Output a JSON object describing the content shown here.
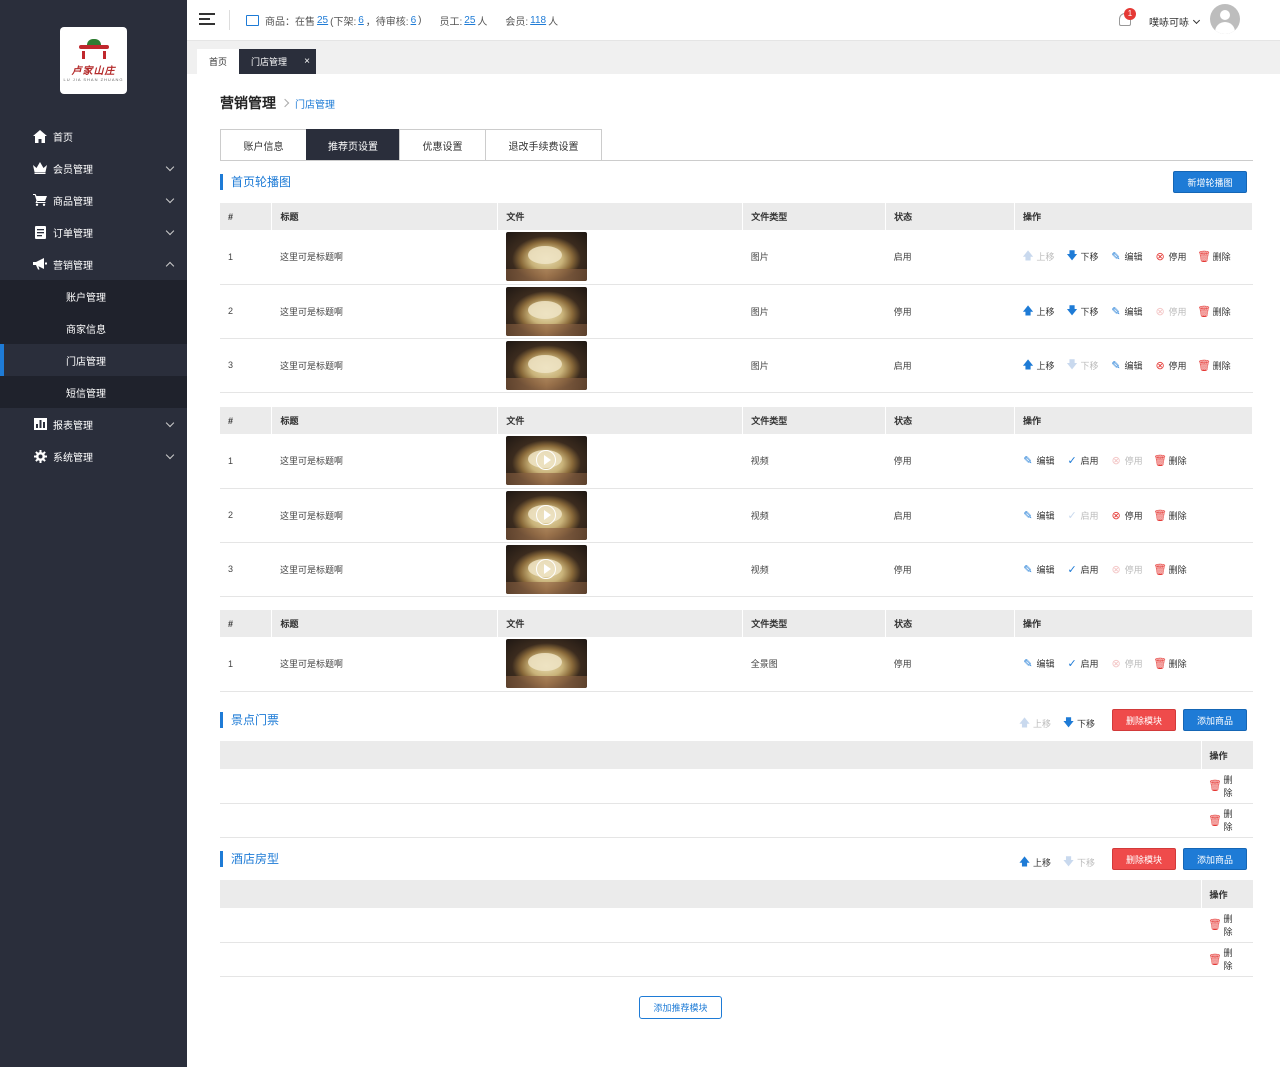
{
  "brand": {
    "name": "卢家山庄",
    "sub": "LU JIA SHAN ZHUANG"
  },
  "nav": {
    "items": [
      {
        "label": "首页",
        "icon": "home-icon"
      },
      {
        "label": "会员管理",
        "icon": "crown-icon"
      },
      {
        "label": "商品管理",
        "icon": "cart-icon"
      },
      {
        "label": "订单管理",
        "icon": "document-icon"
      },
      {
        "label": "营销管理",
        "icon": "megaphone-icon"
      },
      {
        "label": "报表管理",
        "icon": "chart-icon"
      },
      {
        "label": "系统管理",
        "icon": "gear-icon"
      }
    ],
    "sub": [
      "账户管理",
      "商家信息",
      "门店管理",
      "短信管理"
    ]
  },
  "topbar": {
    "goods_label": "商品：在售",
    "on_sale": "25",
    "off_label": "(下架:",
    "off": "6",
    "pending_label": "，待审核:",
    "pending": "6",
    "close": ")",
    "staff_label": "员工:",
    "staff": "25",
    "unit": "人",
    "member_label": "会员:",
    "members": "118",
    "notif_count": "1",
    "user": "噗哧可哧"
  },
  "page_tabs": {
    "home": "首页",
    "current": "门店管理",
    "close": "×"
  },
  "breadcrumb": {
    "parent": "营销管理",
    "current": "门店管理"
  },
  "sub_tabs": [
    "账户信息",
    "推荐页设置",
    "优惠设置",
    "退改手续费设置"
  ],
  "banner": {
    "title": "首页轮播图",
    "add_button": "新增轮播图",
    "headers": [
      "#",
      "标题",
      "文件",
      "文件类型",
      "状态",
      "操作"
    ]
  },
  "ops": {
    "up": "上移",
    "down": "下移",
    "edit": "编辑",
    "stop": "停用",
    "start": "启用",
    "delete": "删除"
  },
  "image_rows": [
    {
      "no": "1",
      "title": "这里可是标题啊",
      "type": "图片",
      "status": "启用"
    },
    {
      "no": "2",
      "title": "这里可是标题啊",
      "type": "图片",
      "status": "停用"
    },
    {
      "no": "3",
      "title": "这里可是标题啊",
      "type": "图片",
      "status": "启用"
    }
  ],
  "video_rows": [
    {
      "no": "1",
      "title": "这里可是标题啊",
      "type": "视频",
      "status": "停用"
    },
    {
      "no": "2",
      "title": "这里可是标题啊",
      "type": "视频",
      "status": "启用"
    },
    {
      "no": "3",
      "title": "这里可是标题啊",
      "type": "视频",
      "status": "停用"
    }
  ],
  "pano_rows": [
    {
      "no": "1",
      "title": "这里可是标题啊",
      "type": "全景图",
      "status": "停用"
    }
  ],
  "modules": [
    {
      "title": "景点门票",
      "up": "上移",
      "down": "下移",
      "delete_module": "删除模块",
      "add_goods": "添加商品",
      "op_header": "操作"
    },
    {
      "title": "酒店房型",
      "up": "上移",
      "down": "下移",
      "delete_module": "删除模块",
      "add_goods": "添加商品",
      "op_header": "操作"
    }
  ],
  "add_module": "添加推荐模块",
  "colors": {
    "accent": "#1e7bd6",
    "sidebar": "#2a2e3b",
    "danger": "#ef4b4b"
  }
}
